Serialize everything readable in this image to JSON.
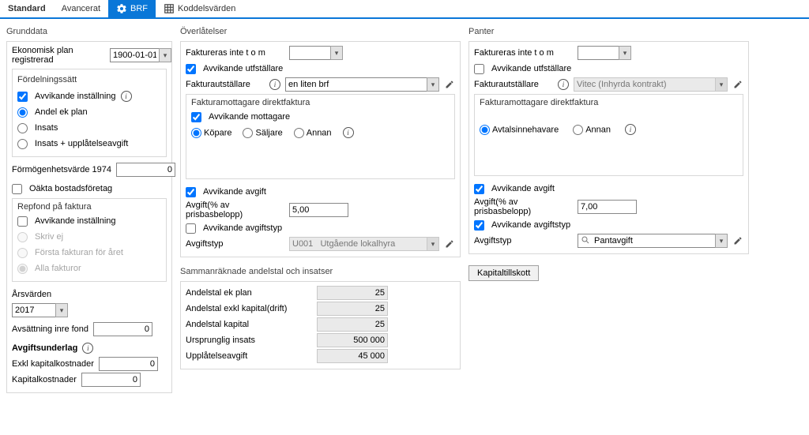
{
  "tabs": {
    "standard": "Standard",
    "avancerat": "Avancerat",
    "brf": "BRF",
    "koddelsvarden": "Koddelsvärden"
  },
  "grunddata": {
    "title": "Grunddata",
    "ekonomisk_plan_label": "Ekonomisk plan registrerad",
    "ekonomisk_plan_date": "1900-01-01",
    "fordelningssatt": {
      "title": "Fördelningssätt",
      "avvikande_installning": "Avvikande inställning",
      "andel_ek_plan": "Andel ek plan",
      "insats": "Insats",
      "insats_upplatelse": "Insats + upplåtelseavgift"
    },
    "formogenhetsvarde_label": "Förmögenhetsvärde 1974",
    "formogenhetsvarde_value": "0",
    "oakta_bostadsforetag": "Oäkta bostadsföretag",
    "repfond": {
      "title": "Repfond på faktura",
      "avvikande_installning": "Avvikande inställning",
      "skriv_ej": "Skriv ej",
      "forsta_fakturan": "Första fakturan för året",
      "alla_fakturor": "Alla fakturor"
    },
    "arsvarden_label": "Årsvärden",
    "arsvarden_value": "2017",
    "avsattning_label": "Avsättning inre fond",
    "avsattning_value": "0",
    "avgiftsunderlag_label": "Avgiftsunderlag",
    "exkl_kap_label": "Exkl kapitalkostnader",
    "exkl_kap_value": "0",
    "kap_label": "Kapitalkostnader",
    "kap_value": "0"
  },
  "overlatelser": {
    "title": "Överlåtelser",
    "faktureras_inte_label": "Faktureras inte t o m",
    "faktureras_inte_value": "",
    "avvikande_utfstallare": "Avvikande utfställare",
    "fakturautstallare_label": "Fakturautställare",
    "fakturautstallare_value": "en liten brf",
    "mottagare": {
      "title": "Fakturamottagare direktfaktura",
      "avvikande_mottagare": "Avvikande mottagare",
      "kopare": "Köpare",
      "saljare": "Säljare",
      "annan": "Annan"
    },
    "avvikande_avgift": "Avvikande avgift",
    "avgift_pct_label": "Avgift(% av prisbasbelopp)",
    "avgift_pct_value": "5,00",
    "avvikande_avgiftstyp": "Avvikande avgiftstyp",
    "avgiftstyp_label": "Avgiftstyp",
    "avgiftstyp_value": "U001   Utgående lokalhyra"
  },
  "sammanraknade": {
    "title": "Sammanräknade andelstal och insatser",
    "andelstal_ek_plan_label": "Andelstal ek plan",
    "andelstal_ek_plan_value": "25",
    "andelstal_exkl_label": "Andelstal exkl kapital(drift)",
    "andelstal_exkl_value": "25",
    "andelstal_kap_label": "Andelstal kapital",
    "andelstal_kap_value": "25",
    "ursprunglig_label": "Ursprunglig insats",
    "ursprunglig_value": "500 000",
    "upplatelse_label": "Upplåtelseavgift",
    "upplatelse_value": "45 000"
  },
  "panter": {
    "title": "Panter",
    "faktureras_inte_label": "Faktureras inte t o m",
    "faktureras_inte_value": "",
    "avvikande_utfstallare": "Avvikande utfställare",
    "fakturautstallare_label": "Fakturautställare",
    "fakturautstallare_value": "Vitec (Inhyrda kontrakt)",
    "mottagare": {
      "title": "Fakturamottagare direktfaktura",
      "avtalsinnehavare": "Avtalsinnehavare",
      "annan": "Annan"
    },
    "avvikande_avgift": "Avvikande avgift",
    "avgift_pct_label": "Avgift(% av prisbasbelopp)",
    "avgift_pct_value": "7,00",
    "avvikande_avgiftstyp": "Avvikande avgiftstyp",
    "avgiftstyp_label": "Avgiftstyp",
    "avgiftstyp_value": "Pantavgift"
  },
  "kapitaltillskott_btn": "Kapitaltillskott"
}
